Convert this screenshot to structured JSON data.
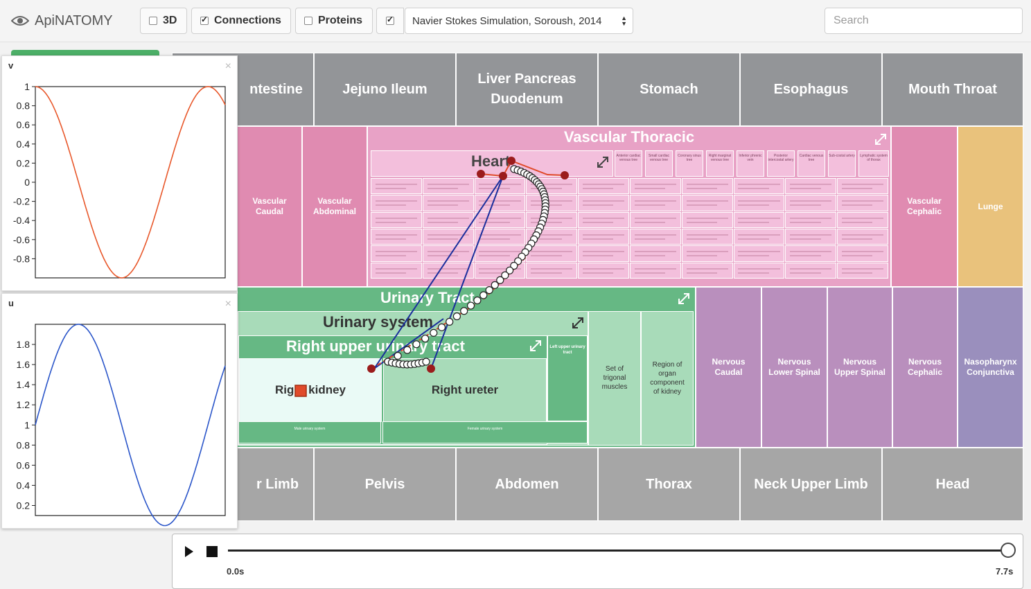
{
  "app": {
    "brand": "ApiNATOMY"
  },
  "toolbar": {
    "toggle_3d": {
      "label": "3D",
      "checked": false
    },
    "toggle_connections": {
      "label": "Connections",
      "checked": true
    },
    "toggle_proteins": {
      "label": "Proteins",
      "checked": false
    },
    "toggle_simulation": {
      "checked": true
    },
    "simulation_select": {
      "value": "Navier Stokes Simulation, Soroush, 2014"
    },
    "search": {
      "placeholder": "Search"
    }
  },
  "treemap": {
    "top_row": [
      "ntestine",
      "Jejuno Ileum",
      "Liver Pancreas\nDuodenum",
      "Stomach",
      "Esophagus",
      "Mouth Throat"
    ],
    "vascular_caudal": "Vascular\nCaudal",
    "vascular_abdominal": "Vascular\nAbdominal",
    "vascular_thoracic": {
      "title": "Vascular Thoracic",
      "heart_title": "Heart"
    },
    "heart_small": [
      "Anterior cardiac venous tree",
      "Small cardiac venous tree",
      "Coronary sinus tree",
      "Right marginal venous tree",
      "Inferior phrenic vein",
      "Posterior intercostal artery",
      "Cardiac venous tree",
      "Sub-costal artery",
      "Lymphatic system of thorax"
    ],
    "vascular_cephalic": "Vascular\nCephalic",
    "lunge": "Lunge",
    "urinary_tract": {
      "title": "Urinary Tract",
      "system_title": "Urinary system",
      "right_upper_title": "Right upper urinary tract",
      "right_kidney": "Right kidney",
      "right_ureter": "Right ureter",
      "left_upper": "Left upper urinary tract",
      "male_system": "Male urinary system",
      "female_system": "Female urinary system",
      "trigonal": "Set of\ntrigonal\nmuscles",
      "region_kidney": "Region of\norgan\ncomponent\nof kidney"
    },
    "nervous": [
      "Nervous\nCaudal",
      "Nervous\nLower Spinal",
      "Nervous\nUpper Spinal",
      "Nervous\nCephalic"
    ],
    "nasopharynx": "Nasopharynx\nConjunctiva",
    "bottom_row": [
      "r Limb",
      "Pelvis",
      "Abdomen",
      "Thorax",
      "Neck Upper Limb",
      "Head"
    ]
  },
  "plots": {
    "v": {
      "title": "v"
    },
    "u": {
      "title": "u"
    }
  },
  "chart_data": [
    {
      "type": "line",
      "title": "v",
      "ylim": [
        -1,
        1
      ],
      "yticks": [
        "1",
        "0.8",
        "0.6",
        "0.4",
        "0.2",
        "0",
        "-0.2",
        "-0.4",
        "-0.6",
        "-0.8"
      ],
      "series": [
        {
          "color": "#e8572a",
          "function": "cos",
          "periods": 1.1,
          "amplitude": 1,
          "offset": 0
        }
      ]
    },
    {
      "type": "line",
      "title": "u",
      "ylim": [
        0.1,
        2.0
      ],
      "yticks": [
        "1.8",
        "1.6",
        "1.4",
        "1.2",
        "1",
        "0.8",
        "0.6",
        "0.4",
        "0.2"
      ],
      "series": [
        {
          "color": "#2a55c9",
          "function": "sin",
          "periods": 1.1,
          "amplitude": 1,
          "offset": 1
        }
      ]
    }
  ],
  "player": {
    "start_time": "0.0s",
    "end_time": "7.7s",
    "progress": 1.0
  }
}
